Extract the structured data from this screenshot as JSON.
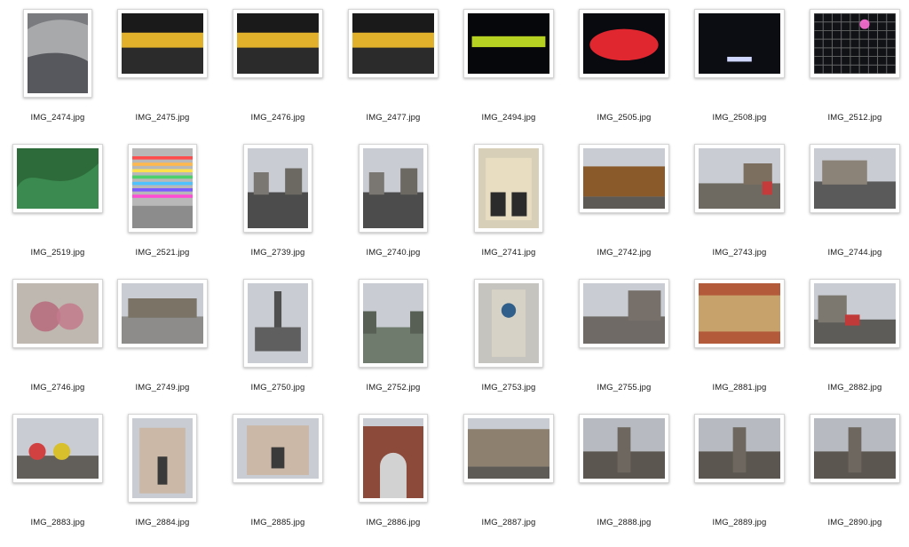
{
  "files": [
    {
      "name": "IMG_2474.jpg",
      "orientation": "portrait",
      "icon": "stadium-interior-photo"
    },
    {
      "name": "IMG_2475.jpg",
      "orientation": "landscape",
      "icon": "stadium-lit-field-photo"
    },
    {
      "name": "IMG_2476.jpg",
      "orientation": "landscape",
      "icon": "stadium-lit-field-photo"
    },
    {
      "name": "IMG_2477.jpg",
      "orientation": "landscape",
      "icon": "stadium-lit-field-photo"
    },
    {
      "name": "IMG_2494.jpg",
      "orientation": "landscape",
      "icon": "stadium-night-field-photo"
    },
    {
      "name": "IMG_2505.jpg",
      "orientation": "landscape",
      "icon": "red-stadium-night-photo"
    },
    {
      "name": "IMG_2508.jpg",
      "orientation": "landscape",
      "icon": "night-sky-photo"
    },
    {
      "name": "IMG_2512.jpg",
      "orientation": "landscape",
      "icon": "night-net-photo"
    },
    {
      "name": "IMG_2519.jpg",
      "orientation": "landscape",
      "icon": "kale-photo"
    },
    {
      "name": "IMG_2521.jpg",
      "orientation": "portrait",
      "icon": "colorful-stairs-photo"
    },
    {
      "name": "IMG_2739.jpg",
      "orientation": "portrait",
      "icon": "street-photo"
    },
    {
      "name": "IMG_2740.jpg",
      "orientation": "portrait",
      "icon": "street-photo"
    },
    {
      "name": "IMG_2741.jpg",
      "orientation": "portrait",
      "icon": "building-facade-photo"
    },
    {
      "name": "IMG_2742.jpg",
      "orientation": "landscape",
      "icon": "market-stall-photo"
    },
    {
      "name": "IMG_2743.jpg",
      "orientation": "landscape",
      "icon": "market-street-photo"
    },
    {
      "name": "IMG_2744.jpg",
      "orientation": "landscape",
      "icon": "city-street-photo"
    },
    {
      "name": "IMG_2746.jpg",
      "orientation": "landscape",
      "icon": "blossom-tree-photo"
    },
    {
      "name": "IMG_2749.jpg",
      "orientation": "landscape",
      "icon": "city-square-photo"
    },
    {
      "name": "IMG_2750.jpg",
      "orientation": "portrait",
      "icon": "tower-building-photo"
    },
    {
      "name": "IMG_2752.jpg",
      "orientation": "portrait",
      "icon": "river-photo"
    },
    {
      "name": "IMG_2753.jpg",
      "orientation": "portrait",
      "icon": "clock-tower-photo"
    },
    {
      "name": "IMG_2755.jpg",
      "orientation": "landscape",
      "icon": "building-street-photo"
    },
    {
      "name": "IMG_2881.jpg",
      "orientation": "landscape",
      "icon": "market-food-photo"
    },
    {
      "name": "IMG_2882.jpg",
      "orientation": "landscape",
      "icon": "street-cafe-photo"
    },
    {
      "name": "IMG_2883.jpg",
      "orientation": "landscape",
      "icon": "umbrella-cafe-photo"
    },
    {
      "name": "IMG_2884.jpg",
      "orientation": "portrait",
      "icon": "church-facade-photo"
    },
    {
      "name": "IMG_2885.jpg",
      "orientation": "landscape",
      "icon": "church-facade-photo"
    },
    {
      "name": "IMG_2886.jpg",
      "orientation": "portrait",
      "icon": "stone-arch-gate-photo"
    },
    {
      "name": "IMG_2887.jpg",
      "orientation": "landscape",
      "icon": "building-row-photo"
    },
    {
      "name": "IMG_2888.jpg",
      "orientation": "landscape",
      "icon": "city-hall-aerial-photo"
    },
    {
      "name": "IMG_2889.jpg",
      "orientation": "landscape",
      "icon": "city-hall-aerial-photo"
    },
    {
      "name": "IMG_2890.jpg",
      "orientation": "landscape",
      "icon": "city-hall-aerial-photo"
    }
  ]
}
